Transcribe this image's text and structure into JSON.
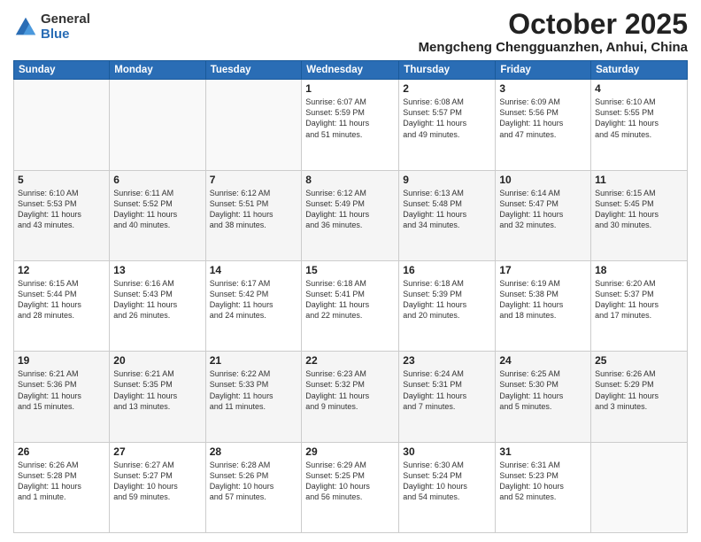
{
  "logo": {
    "general": "General",
    "blue": "Blue"
  },
  "header": {
    "month": "October 2025",
    "location": "Mengcheng Chengguanzhen, Anhui, China"
  },
  "weekdays": [
    "Sunday",
    "Monday",
    "Tuesday",
    "Wednesday",
    "Thursday",
    "Friday",
    "Saturday"
  ],
  "weeks": [
    [
      {
        "day": "",
        "info": ""
      },
      {
        "day": "",
        "info": ""
      },
      {
        "day": "",
        "info": ""
      },
      {
        "day": "1",
        "info": "Sunrise: 6:07 AM\nSunset: 5:59 PM\nDaylight: 11 hours\nand 51 minutes."
      },
      {
        "day": "2",
        "info": "Sunrise: 6:08 AM\nSunset: 5:57 PM\nDaylight: 11 hours\nand 49 minutes."
      },
      {
        "day": "3",
        "info": "Sunrise: 6:09 AM\nSunset: 5:56 PM\nDaylight: 11 hours\nand 47 minutes."
      },
      {
        "day": "4",
        "info": "Sunrise: 6:10 AM\nSunset: 5:55 PM\nDaylight: 11 hours\nand 45 minutes."
      }
    ],
    [
      {
        "day": "5",
        "info": "Sunrise: 6:10 AM\nSunset: 5:53 PM\nDaylight: 11 hours\nand 43 minutes."
      },
      {
        "day": "6",
        "info": "Sunrise: 6:11 AM\nSunset: 5:52 PM\nDaylight: 11 hours\nand 40 minutes."
      },
      {
        "day": "7",
        "info": "Sunrise: 6:12 AM\nSunset: 5:51 PM\nDaylight: 11 hours\nand 38 minutes."
      },
      {
        "day": "8",
        "info": "Sunrise: 6:12 AM\nSunset: 5:49 PM\nDaylight: 11 hours\nand 36 minutes."
      },
      {
        "day": "9",
        "info": "Sunrise: 6:13 AM\nSunset: 5:48 PM\nDaylight: 11 hours\nand 34 minutes."
      },
      {
        "day": "10",
        "info": "Sunrise: 6:14 AM\nSunset: 5:47 PM\nDaylight: 11 hours\nand 32 minutes."
      },
      {
        "day": "11",
        "info": "Sunrise: 6:15 AM\nSunset: 5:45 PM\nDaylight: 11 hours\nand 30 minutes."
      }
    ],
    [
      {
        "day": "12",
        "info": "Sunrise: 6:15 AM\nSunset: 5:44 PM\nDaylight: 11 hours\nand 28 minutes."
      },
      {
        "day": "13",
        "info": "Sunrise: 6:16 AM\nSunset: 5:43 PM\nDaylight: 11 hours\nand 26 minutes."
      },
      {
        "day": "14",
        "info": "Sunrise: 6:17 AM\nSunset: 5:42 PM\nDaylight: 11 hours\nand 24 minutes."
      },
      {
        "day": "15",
        "info": "Sunrise: 6:18 AM\nSunset: 5:41 PM\nDaylight: 11 hours\nand 22 minutes."
      },
      {
        "day": "16",
        "info": "Sunrise: 6:18 AM\nSunset: 5:39 PM\nDaylight: 11 hours\nand 20 minutes."
      },
      {
        "day": "17",
        "info": "Sunrise: 6:19 AM\nSunset: 5:38 PM\nDaylight: 11 hours\nand 18 minutes."
      },
      {
        "day": "18",
        "info": "Sunrise: 6:20 AM\nSunset: 5:37 PM\nDaylight: 11 hours\nand 17 minutes."
      }
    ],
    [
      {
        "day": "19",
        "info": "Sunrise: 6:21 AM\nSunset: 5:36 PM\nDaylight: 11 hours\nand 15 minutes."
      },
      {
        "day": "20",
        "info": "Sunrise: 6:21 AM\nSunset: 5:35 PM\nDaylight: 11 hours\nand 13 minutes."
      },
      {
        "day": "21",
        "info": "Sunrise: 6:22 AM\nSunset: 5:33 PM\nDaylight: 11 hours\nand 11 minutes."
      },
      {
        "day": "22",
        "info": "Sunrise: 6:23 AM\nSunset: 5:32 PM\nDaylight: 11 hours\nand 9 minutes."
      },
      {
        "day": "23",
        "info": "Sunrise: 6:24 AM\nSunset: 5:31 PM\nDaylight: 11 hours\nand 7 minutes."
      },
      {
        "day": "24",
        "info": "Sunrise: 6:25 AM\nSunset: 5:30 PM\nDaylight: 11 hours\nand 5 minutes."
      },
      {
        "day": "25",
        "info": "Sunrise: 6:26 AM\nSunset: 5:29 PM\nDaylight: 11 hours\nand 3 minutes."
      }
    ],
    [
      {
        "day": "26",
        "info": "Sunrise: 6:26 AM\nSunset: 5:28 PM\nDaylight: 11 hours\nand 1 minute."
      },
      {
        "day": "27",
        "info": "Sunrise: 6:27 AM\nSunset: 5:27 PM\nDaylight: 10 hours\nand 59 minutes."
      },
      {
        "day": "28",
        "info": "Sunrise: 6:28 AM\nSunset: 5:26 PM\nDaylight: 10 hours\nand 57 minutes."
      },
      {
        "day": "29",
        "info": "Sunrise: 6:29 AM\nSunset: 5:25 PM\nDaylight: 10 hours\nand 56 minutes."
      },
      {
        "day": "30",
        "info": "Sunrise: 6:30 AM\nSunset: 5:24 PM\nDaylight: 10 hours\nand 54 minutes."
      },
      {
        "day": "31",
        "info": "Sunrise: 6:31 AM\nSunset: 5:23 PM\nDaylight: 10 hours\nand 52 minutes."
      },
      {
        "day": "",
        "info": ""
      }
    ]
  ]
}
